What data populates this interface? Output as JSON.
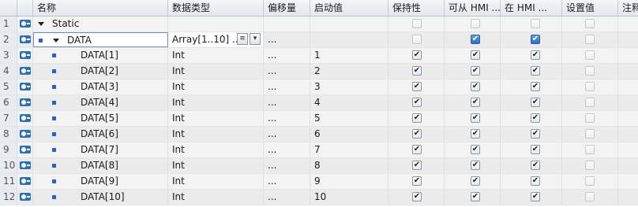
{
  "columns": {
    "name": "名称",
    "data_type": "数据类型",
    "offset": "偏移量",
    "start_value": "启动值",
    "retain": "保持性",
    "hmi_accessible": "可从 HMI ...",
    "hmi_visible": "在 HMI ...",
    "setpoint": "设置值",
    "comment": "注释"
  },
  "rows": [
    {
      "num": "1",
      "name": "Static",
      "type": "",
      "offset": "",
      "start": "",
      "keep": false,
      "hmi1": false,
      "hmi2": false,
      "set": false
    },
    {
      "num": "2",
      "name": "DATA",
      "type": "Array[1..10] ...",
      "offset": "...",
      "start": "",
      "keep": false,
      "hmi1": true,
      "hmi2": true,
      "set": false
    },
    {
      "num": "3",
      "name": "DATA[1]",
      "type": "Int",
      "offset": "...",
      "start": "1",
      "keep": true,
      "hmi1": true,
      "hmi2": true,
      "set": false
    },
    {
      "num": "4",
      "name": "DATA[2]",
      "type": "Int",
      "offset": "...",
      "start": "2",
      "keep": true,
      "hmi1": true,
      "hmi2": true,
      "set": false
    },
    {
      "num": "5",
      "name": "DATA[3]",
      "type": "Int",
      "offset": "...",
      "start": "3",
      "keep": true,
      "hmi1": true,
      "hmi2": true,
      "set": false
    },
    {
      "num": "6",
      "name": "DATA[4]",
      "type": "Int",
      "offset": "...",
      "start": "4",
      "keep": true,
      "hmi1": true,
      "hmi2": true,
      "set": false
    },
    {
      "num": "7",
      "name": "DATA[5]",
      "type": "Int",
      "offset": "...",
      "start": "5",
      "keep": true,
      "hmi1": true,
      "hmi2": true,
      "set": false
    },
    {
      "num": "8",
      "name": "DATA[6]",
      "type": "Int",
      "offset": "...",
      "start": "6",
      "keep": true,
      "hmi1": true,
      "hmi2": true,
      "set": false
    },
    {
      "num": "9",
      "name": "DATA[7]",
      "type": "Int",
      "offset": "...",
      "start": "7",
      "keep": true,
      "hmi1": true,
      "hmi2": true,
      "set": false
    },
    {
      "num": "10",
      "name": "DATA[8]",
      "type": "Int",
      "offset": "...",
      "start": "8",
      "keep": true,
      "hmi1": true,
      "hmi2": true,
      "set": false
    },
    {
      "num": "11",
      "name": "DATA[9]",
      "type": "Int",
      "offset": "...",
      "start": "9",
      "keep": true,
      "hmi1": true,
      "hmi2": true,
      "set": false
    },
    {
      "num": "12",
      "name": "DATA[10]",
      "type": "Int",
      "offset": "...",
      "start": "10",
      "keep": true,
      "hmi1": true,
      "hmi2": true,
      "set": false
    }
  ],
  "icons": {
    "interface": "interface-icon",
    "expand": "expand-triangle-icon",
    "member": "member-square-icon",
    "check": "✔",
    "type_picker": "▾"
  },
  "colors": {
    "selection_border": "#6e8fb8",
    "checkbox_selected": "#2e6fc8",
    "member_square": "#2b62c8"
  }
}
